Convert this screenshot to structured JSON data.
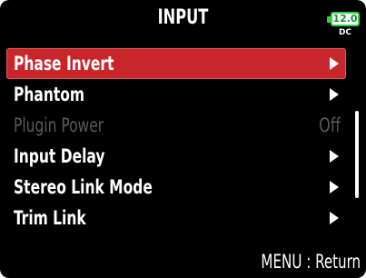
{
  "header": {
    "title": "INPUT",
    "battery": {
      "voltage": "12.0",
      "source": "DC",
      "color": "#2fd14a"
    }
  },
  "menu": {
    "items": [
      {
        "label": "Phase Invert",
        "selected": true,
        "enabled": true,
        "arrow": true
      },
      {
        "label": "Phantom",
        "selected": false,
        "enabled": true,
        "arrow": true
      },
      {
        "label": "Plugin Power",
        "selected": false,
        "enabled": false,
        "value": "Off"
      },
      {
        "label": "Input Delay",
        "selected": false,
        "enabled": true,
        "arrow": true
      },
      {
        "label": "Stereo Link Mode",
        "selected": false,
        "enabled": true,
        "arrow": true
      },
      {
        "label": "Trim Link",
        "selected": false,
        "enabled": true,
        "arrow": true
      }
    ]
  },
  "footer": {
    "hint": "MENU : Return"
  },
  "colors": {
    "selection": "#c8262b",
    "background": "#000000",
    "disabled_text": "#5a5a5a"
  }
}
